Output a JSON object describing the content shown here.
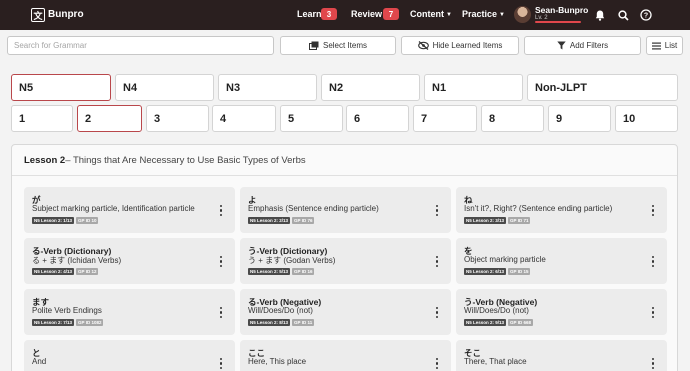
{
  "nav": {
    "logo_glyph": "文",
    "brand": "Bunpro",
    "learn_label": "Learn",
    "learn_count": "3",
    "review_label": "Review",
    "review_count": "7",
    "content_label": "Content",
    "practice_label": "Practice",
    "user_name": "Sean-Bunpro",
    "user_level": "Lv. 2",
    "icons": [
      "bell-icon",
      "search-icon",
      "help-icon"
    ],
    "accent_color": "#e0474c"
  },
  "toolbar": {
    "search_placeholder": "Search for Grammar",
    "select_items": "Select Items",
    "hide_learned": "Hide Learned Items",
    "add_filters": "Add Filters",
    "list": "List"
  },
  "jlpt_levels": [
    "N5",
    "N4",
    "N3",
    "N2",
    "N1",
    "Non-JLPT"
  ],
  "selected_level": "N5",
  "lessons": [
    "1",
    "2",
    "3",
    "4",
    "5",
    "6",
    "7",
    "8",
    "9",
    "10"
  ],
  "selected_lesson": "2",
  "panel": {
    "lesson_label": "Lesson 2",
    "lesson_subtitle": " – Things that Are Necessary to Use Basic Types of Verbs"
  },
  "cards": [
    {
      "title": "が",
      "meaning": "Subject marking particle, Identification particle",
      "tag": "N5 Lesson 2: 1/13",
      "gp": "GP ID 10"
    },
    {
      "title": "よ",
      "meaning": "Emphasis (Sentence ending particle)",
      "tag": "N5 Lesson 2: 2/13",
      "gp": "GP ID 76"
    },
    {
      "title": "ね",
      "meaning": "Isn't it?, Right? (Sentence ending particle)",
      "tag": "N5 Lesson 2: 3/13",
      "gp": "GP ID 71"
    },
    {
      "title": "る-Verb (Dictionary)",
      "meaning": "る + ます (Ichidan Verbs)",
      "tag": "N5 Lesson 2: 4/13",
      "gp": "GP ID 12"
    },
    {
      "title": "う-Verb (Dictionary)",
      "meaning": "う + ます (Godan Verbs)",
      "tag": "N5 Lesson 2: 5/13",
      "gp": "GP ID 16"
    },
    {
      "title": "を",
      "meaning": "Object marking particle",
      "tag": "N5 Lesson 2: 6/13",
      "gp": "GP ID 15"
    },
    {
      "title": "ます",
      "meaning": "Polite Verb Endings",
      "tag": "N5 Lesson 2: 7/13",
      "gp": "GP ID 1082"
    },
    {
      "title": "る-Verb (Negative)",
      "meaning": "Will/Does/Do (not)",
      "tag": "N5 Lesson 2: 8/13",
      "gp": "GP ID 11"
    },
    {
      "title": "う-Verb (Negative)",
      "meaning": "Will/Does/Do (not)",
      "tag": "N5 Lesson 2: 9/13",
      "gp": "GP ID 668"
    },
    {
      "title": "と",
      "meaning": "And",
      "tag": "",
      "gp": ""
    },
    {
      "title": "ここ",
      "meaning": "Here, This place",
      "tag": "",
      "gp": ""
    },
    {
      "title": "そこ",
      "meaning": "There, That place",
      "tag": "",
      "gp": ""
    }
  ]
}
